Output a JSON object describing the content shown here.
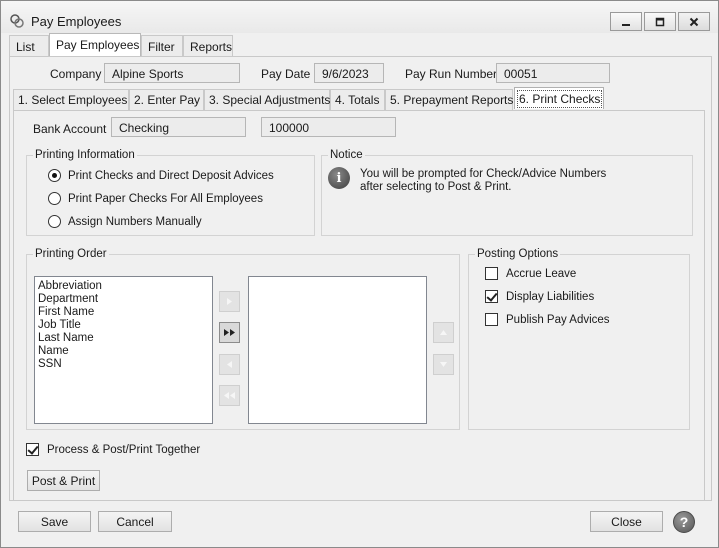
{
  "window": {
    "title": "Pay Employees",
    "minimize_icon": "minimize-icon",
    "maximize_icon": "maximize-icon",
    "close_icon": "close-icon"
  },
  "top_tabs": [
    {
      "label": "List"
    },
    {
      "label": "Pay Employees",
      "active": true
    },
    {
      "label": "Filter"
    },
    {
      "label": "Reports"
    }
  ],
  "header": {
    "company_label": "Company",
    "company_value": "Alpine Sports",
    "paydate_label": "Pay Date",
    "paydate_value": "9/6/2023",
    "payrun_label": "Pay Run Number",
    "payrun_value": "00051"
  },
  "sub_tabs": [
    {
      "label": "1. Select Employees"
    },
    {
      "label": "2. Enter Pay"
    },
    {
      "label": "3. Special Adjustments"
    },
    {
      "label": "4. Totals"
    },
    {
      "label": "5. Prepayment Reports"
    },
    {
      "label": "6. Print Checks",
      "active": true
    }
  ],
  "bank": {
    "label": "Bank Account",
    "name": "Checking",
    "number": "100000"
  },
  "printing_information": {
    "title": "Printing Information",
    "options": [
      {
        "label": "Print Checks and Direct Deposit Advices",
        "selected": true
      },
      {
        "label": "Print Paper Checks For All Employees",
        "selected": false
      },
      {
        "label": "Assign Numbers Manually",
        "selected": false
      }
    ]
  },
  "notice": {
    "title": "Notice",
    "line1": "You will be prompted for Check/Advice Numbers",
    "line2": "after selecting to Post & Print.",
    "icon": "info-icon"
  },
  "printing_order": {
    "title": "Printing Order",
    "available": [
      "Abbreviation",
      "Department",
      "First Name",
      "Job Title",
      "Last Name",
      "Name",
      "SSN"
    ],
    "selected": []
  },
  "posting_options": {
    "title": "Posting Options",
    "items": [
      {
        "label": "Accrue Leave",
        "checked": false
      },
      {
        "label": "Display Liabilities",
        "checked": true
      },
      {
        "label": "Publish Pay Advices",
        "checked": false
      }
    ]
  },
  "process_together": {
    "label": "Process & Post/Print Together",
    "checked": true
  },
  "buttons": {
    "post_print": "Post & Print",
    "save": "Save",
    "cancel": "Cancel",
    "close": "Close"
  },
  "colors": {
    "window_bg": "#f0f0f0",
    "border": "#c9c9c9"
  }
}
